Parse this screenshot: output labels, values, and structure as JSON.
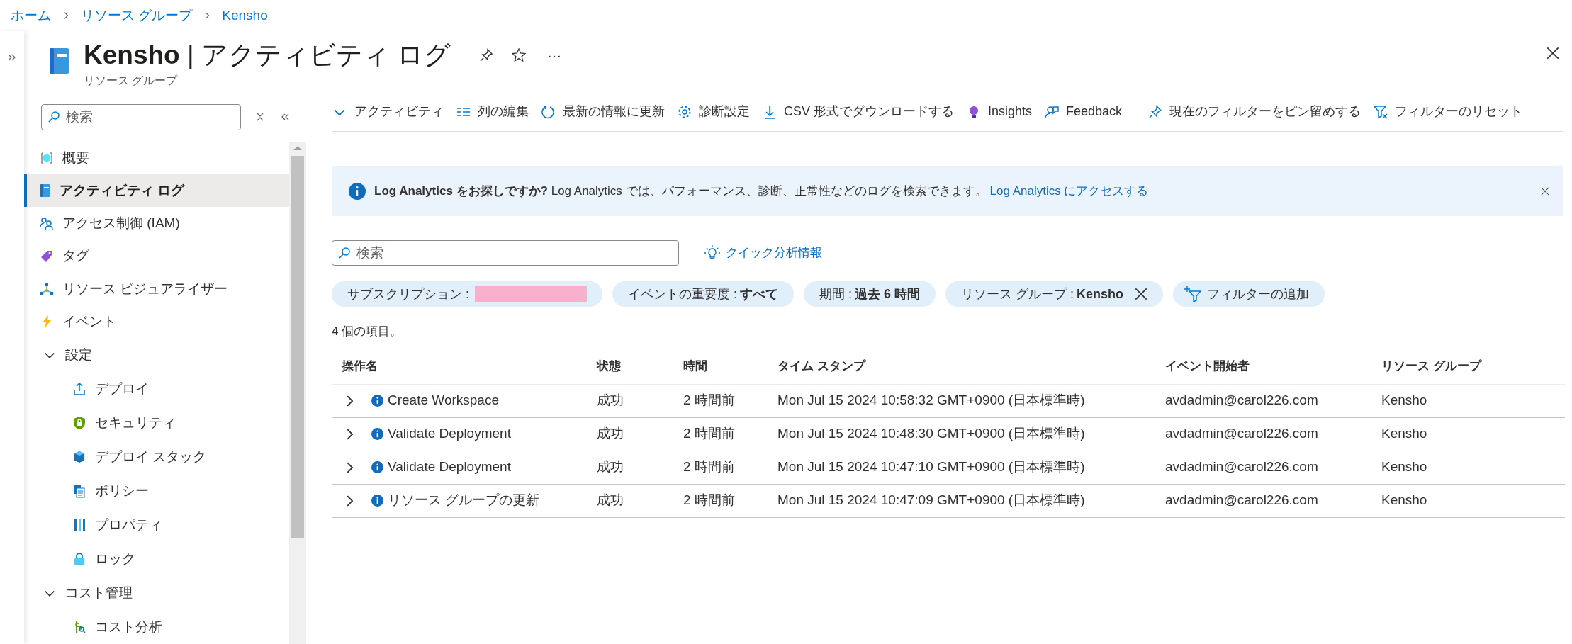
{
  "breadcrumb": [
    "ホーム",
    "リソース グループ",
    "Kensho"
  ],
  "header": {
    "title": "Kensho",
    "section": "アクティビティ ログ",
    "separator": "|",
    "subtitle": "リソース グループ",
    "more": "···"
  },
  "sidebar": {
    "search": {
      "placeholder": "検索"
    },
    "items": [
      {
        "label": "概要",
        "selected": false
      },
      {
        "label": "アクティビティ ログ",
        "selected": true
      },
      {
        "label": "アクセス制御 (IAM)",
        "selected": false
      },
      {
        "label": "タグ",
        "selected": false
      },
      {
        "label": "リソース ビジュアライザー",
        "selected": false
      },
      {
        "label": "イベント",
        "selected": false
      },
      {
        "label": "設定",
        "selected": false,
        "expanded": true,
        "children": [
          {
            "label": "デプロイ",
            "selected": false
          },
          {
            "label": "セキュリティ",
            "selected": false
          },
          {
            "label": "デプロイ スタック",
            "selected": false
          },
          {
            "label": "ポリシー",
            "selected": false
          },
          {
            "label": "プロパティ",
            "selected": false
          },
          {
            "label": "ロック",
            "selected": false
          }
        ]
      },
      {
        "label": "コスト管理",
        "selected": false,
        "expanded": true,
        "children": [
          {
            "label": "コスト分析",
            "selected": false
          }
        ]
      }
    ]
  },
  "toolbar": {
    "primary": [
      "アクティビティ",
      "列の編集",
      "最新の情報に更新",
      "診断設定",
      "CSV 形式でダウンロードする",
      "Insights",
      "Feedback"
    ],
    "secondary": [
      "現在のフィルターをピン留めする",
      "フィルターのリセット"
    ]
  },
  "banner": {
    "text": "**Log Analytics をお探しですか?** Log Analytics では、パフォーマンス、診断、正常性などのログを検索できます。",
    "link": "Log Analytics にアクセスする"
  },
  "search": {
    "placeholder": "検索"
  },
  "quick_insights": "クイック分析情報",
  "filters": [
    {
      "label": "サブスクリプション : ",
      "redacted": true,
      "removable": false
    },
    {
      "label": "イベントの重要度 : ",
      "value": "すべて",
      "redacted": false,
      "removable": false
    },
    {
      "label": "期間 : ",
      "value": "過去 6 時間",
      "redacted": false,
      "removable": false
    },
    {
      "label": "リソース グループ : ",
      "value": "Kensho",
      "redacted": false,
      "removable": true
    }
  ],
  "add_filter": "フィルターの追加",
  "count": "4 個の項目。",
  "table": {
    "columns": [
      "操作名",
      "状態",
      "時間",
      "タイム スタンプ",
      "イベント開始者",
      "リソース グループ"
    ],
    "rows": [
      {
        "expanded": false,
        "cells": [
          "Create Workspace",
          "成功",
          "2 時間前",
          "Mon Jul 15 2024 10:58:32 GMT+0900 (日本標準時)",
          "avdadmin@carol226.com",
          "Kensho"
        ]
      },
      {
        "expanded": false,
        "cells": [
          "Validate Deployment",
          "成功",
          "2 時間前",
          "Mon Jul 15 2024 10:48:30 GMT+0900 (日本標準時)",
          "avdadmin@carol226.com",
          "Kensho"
        ]
      },
      {
        "expanded": false,
        "cells": [
          "Validate Deployment",
          "成功",
          "2 時間前",
          "Mon Jul 15 2024 10:47:10 GMT+0900 (日本標準時)",
          "avdadmin@carol226.com",
          "Kensho"
        ]
      },
      {
        "expanded": false,
        "cells": [
          "リソース グループの更新",
          "成功",
          "2 時間前",
          "Mon Jul 15 2024 10:47:09 GMT+0900 (日本標準時)",
          "avdadmin@carol226.com",
          "Kensho"
        ]
      }
    ]
  }
}
